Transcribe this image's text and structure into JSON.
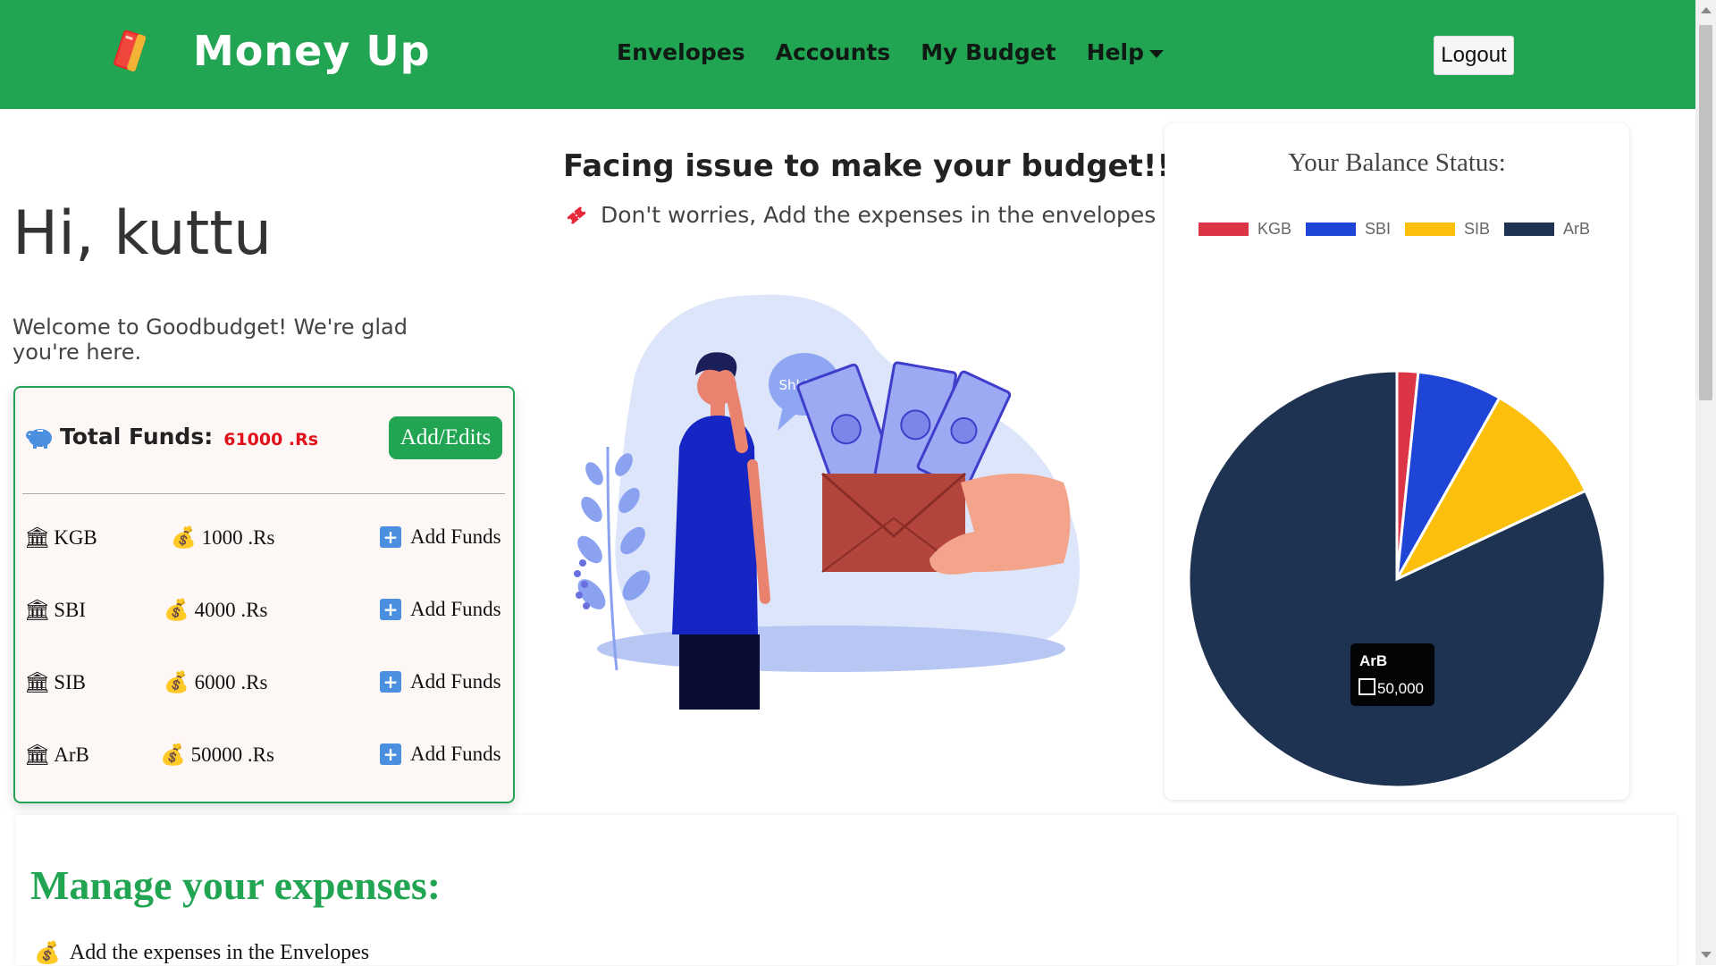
{
  "brand": {
    "name": "Money Up"
  },
  "nav": {
    "links": [
      "Envelopes",
      "Accounts",
      "My Budget"
    ],
    "help_label": "Help",
    "logout_label": "Logout"
  },
  "greeting": {
    "title": "Hi, kuttu",
    "welcome": "Welcome to Goodbudget! We're glad you're here."
  },
  "funds": {
    "label": "Total Funds:",
    "total": "61000 .Rs",
    "edit_button": "Add/Edits",
    "add_funds_label": "Add Funds",
    "accounts": [
      {
        "bank": "KGB",
        "amount": "1000 .Rs"
      },
      {
        "bank": "SBI",
        "amount": "4000 .Rs"
      },
      {
        "bank": "SIB",
        "amount": "6000 .Rs"
      },
      {
        "bank": "ArB",
        "amount": "50000 .Rs"
      }
    ]
  },
  "promo": {
    "title": "Facing issue to make your budget!!",
    "subtitle": "Don't worries, Add the expenses in the envelopes",
    "speech_bubble": "Shhhhh"
  },
  "chart_data": {
    "type": "pie",
    "title": "Your Balance Status:",
    "categories": [
      "KGB",
      "SBI",
      "SIB",
      "ArB"
    ],
    "values": [
      1000,
      4000,
      6000,
      50000
    ],
    "colors": [
      "#dc3545",
      "#1f45d6",
      "#fcbf0c",
      "#1e3252"
    ],
    "legend_position": "top",
    "tooltip": {
      "label": "ArB",
      "value": "50,000"
    }
  },
  "manage": {
    "title": "Manage your expenses:",
    "item": "Add the expenses in the Envelopes"
  }
}
